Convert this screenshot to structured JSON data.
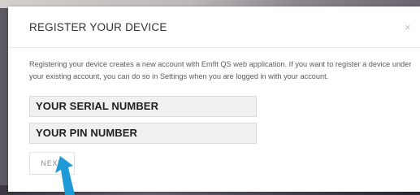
{
  "modal": {
    "title": "REGISTER YOUR DEVICE",
    "close_symbol": "×",
    "description": "Registering your device creates a new account with Emfit QS web application. If you want to register a device under your existing account, you can do so in Settings when you are logged in with your account."
  },
  "form": {
    "serial_label": "YOUR SERIAL NUMBER",
    "pin_label": "YOUR PIN NUMBER",
    "next_label": "NEXT"
  },
  "annotation": {
    "arrow_icon": "pointer-arrow-icon",
    "arrow_color": "#1e9ad6"
  }
}
